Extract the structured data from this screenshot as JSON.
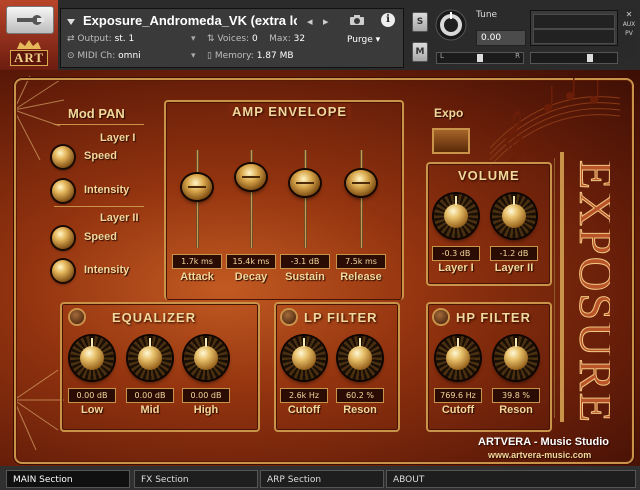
{
  "header": {
    "instrument_name": "Exposure_Andromeda_VK (extra lor",
    "output_label": "Output:",
    "output_value": "st. 1",
    "voices_label": "Voices:",
    "voices_value": "0",
    "max_label": "Max:",
    "max_value": "32",
    "purge_label": "Purge",
    "midi_label": "MIDI Ch:",
    "midi_value": "omni",
    "memory_label": "Memory:",
    "memory_value": "1.87 MB",
    "solo_label": "S",
    "mute_label": "M",
    "tune_label": "Tune",
    "tune_value": "0.00",
    "pan_left": "L",
    "pan_right": "R",
    "aux_label": "AUX",
    "pv_label": "PV",
    "logo_text": "ART"
  },
  "mod_pan": {
    "title": "Mod PAN",
    "layer1": "Layer I",
    "layer2": "Layer II",
    "speed": "Speed",
    "intensity": "Intensity"
  },
  "amp_envelope": {
    "title": "AMP ENVELOPE",
    "sliders": [
      {
        "label": "Attack",
        "value": "1.7k ms",
        "level": 0.62
      },
      {
        "label": "Decay",
        "value": "15.4k ms",
        "level": 0.72
      },
      {
        "label": "Sustain",
        "value": "-3.1 dB",
        "level": 0.66
      },
      {
        "label": "Release",
        "value": "7.5k ms",
        "level": 0.66
      }
    ]
  },
  "expo": {
    "label": "Expo"
  },
  "volume": {
    "title": "VOLUME",
    "knobs": [
      {
        "label": "Layer I",
        "value": "-0.3 dB"
      },
      {
        "label": "Layer II",
        "value": "-1.2 dB"
      }
    ]
  },
  "equalizer": {
    "title": "EQUALIZER",
    "knobs": [
      {
        "label": "Low",
        "value": "0.00 dB"
      },
      {
        "label": "Mid",
        "value": "0.00 dB"
      },
      {
        "label": "High",
        "value": "0.00 dB"
      }
    ]
  },
  "lp_filter": {
    "title": "LP FILTER",
    "knobs": [
      {
        "label": "Cutoff",
        "value": "2.6k Hz"
      },
      {
        "label": "Reson",
        "value": "60.2 %"
      }
    ]
  },
  "hp_filter": {
    "title": "HP FILTER",
    "knobs": [
      {
        "label": "Cutoff",
        "value": "769.6 Hz"
      },
      {
        "label": "Reson",
        "value": "39.8 %"
      }
    ]
  },
  "brand": {
    "product": "EXPOSURE",
    "studio": "ARTVERA - Music Studio",
    "url": "www.artvera-music.com"
  },
  "tabs": [
    "MAIN Section",
    "FX Section",
    "ARP Section",
    "ABOUT"
  ],
  "colors": {
    "gold": "#c9934a",
    "label": "#f2d89a",
    "bg_dark": "#3b0e04"
  }
}
